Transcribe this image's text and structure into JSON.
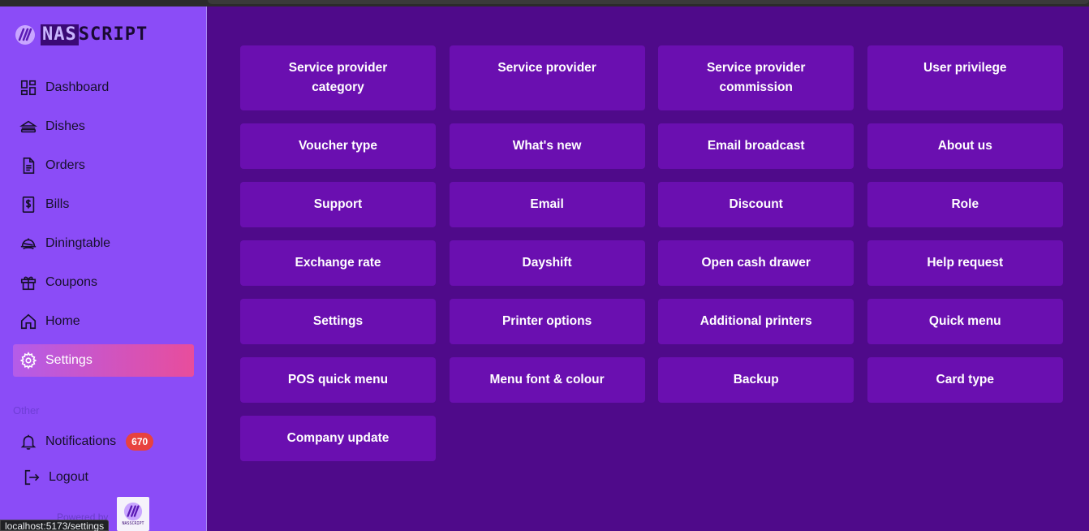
{
  "app": {
    "logo_nas": "NAS",
    "logo_script": "SCRIPT"
  },
  "sidebar": {
    "items": [
      {
        "label": "Dashboard",
        "icon": "grid-icon"
      },
      {
        "label": "Dishes",
        "icon": "sandwich-icon"
      },
      {
        "label": "Orders",
        "icon": "document-icon"
      },
      {
        "label": "Bills",
        "icon": "receipt-dollar-icon"
      },
      {
        "label": "Diningtable",
        "icon": "cloche-icon"
      },
      {
        "label": "Coupons",
        "icon": "gift-icon"
      },
      {
        "label": "Home",
        "icon": "home-icon"
      },
      {
        "label": "Settings",
        "icon": "gear-icon",
        "active": true
      }
    ],
    "section_other": "Other",
    "notifications_label": "Notifications",
    "notifications_count": "670",
    "logout_label": "Logout",
    "powered_by": "Powered by"
  },
  "status_url": "localhost:5173/settings",
  "tiles": [
    [
      "Service provider category",
      "Service provider",
      "Service provider commission",
      "User privilege"
    ],
    [
      "Voucher type",
      "What's new",
      "Email broadcast",
      "About us"
    ],
    [
      "Support",
      "Email",
      "Discount",
      "Role"
    ],
    [
      "Exchange rate",
      "Dayshift",
      "Open cash drawer",
      "Help request"
    ],
    [
      "Settings",
      "Printer options",
      "Additional printers",
      "Quick menu"
    ],
    [
      "POS quick menu",
      "Menu font & colour",
      "Backup",
      "Card type"
    ],
    [
      "Company update"
    ]
  ],
  "colors": {
    "main_bg": "#4f0a8a",
    "sidebar_bg": "#8b4cf7",
    "tile_bg": "#6a0fb0",
    "active_gradient_start": "#b45ce9",
    "active_gradient_end": "#e84d9c",
    "badge": "#e8423f"
  }
}
